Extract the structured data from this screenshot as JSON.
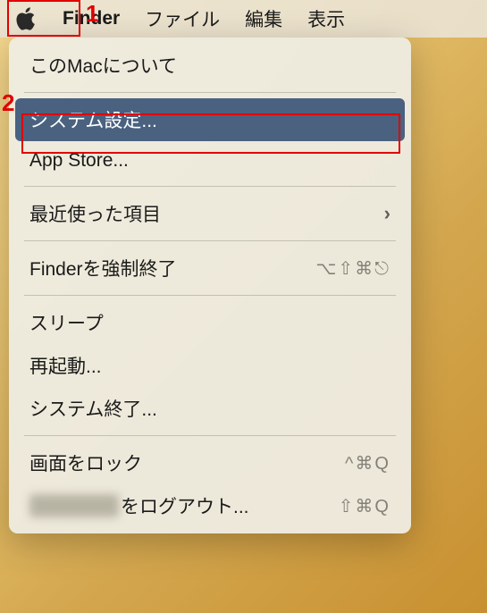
{
  "menubar": {
    "app_name": "Finder",
    "items": [
      "ファイル",
      "編集",
      "表示"
    ]
  },
  "apple_menu": {
    "about": "このMacについて",
    "system_settings": "システム設定...",
    "app_store": "App Store...",
    "recent_items": "最近使った項目",
    "force_quit": "Finderを強制終了",
    "force_quit_shortcut": "⌥⇧⌘⎋",
    "sleep": "スリープ",
    "restart": "再起動...",
    "shutdown": "システム終了...",
    "lock_screen": "画面をロック",
    "lock_screen_shortcut": "^⌘Q",
    "logout_suffix": "をログアウト...",
    "logout_shortcut": "⇧⌘Q"
  },
  "annotations": {
    "label1": "1",
    "label2": "2"
  }
}
